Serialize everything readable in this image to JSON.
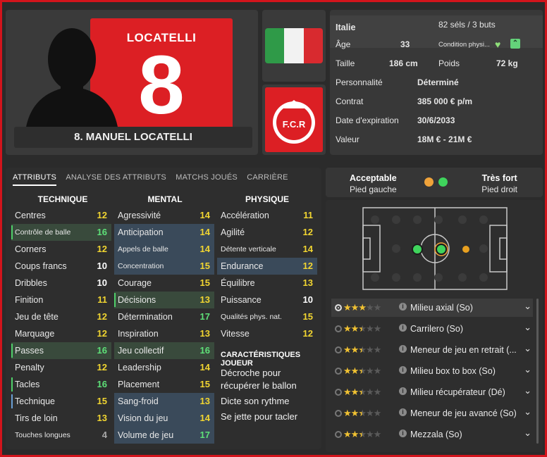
{
  "player": {
    "shirt_name": "LOCATELLI",
    "shirt_number": "8",
    "full_name": "8. MANUEL LOCATELLI"
  },
  "colors": {
    "accent_red": "#dc1f24",
    "attr_yellow": "#f1d531",
    "attr_green": "#5ee078",
    "left_foot_dot": "#f0a33a",
    "right_foot_dot": "#3fd45c"
  },
  "info": {
    "nation": "Italie",
    "caps": "82 séls / 3 buts",
    "age_label": "Âge",
    "age": "33",
    "condition_label": "Condition physi...",
    "height_label": "Taille",
    "height": "186 cm",
    "weight_label": "Poids",
    "weight": "72 kg",
    "personality_label": "Personnalité",
    "personality": "Déterminé",
    "contract_label": "Contrat",
    "contract": "385 000 € p/m",
    "expiry_label": "Date d'expiration",
    "expiry": "30/6/2033",
    "value_label": "Valeur",
    "value": "18M € - 21M €"
  },
  "tabs": [
    "ATTRIBUTS",
    "ANALYSE DES ATTRIBUTS",
    "MATCHS JOUÉS",
    "CARRIÈRE"
  ],
  "columns": {
    "technique": "TECHNIQUE",
    "mental": "MENTAL",
    "physique": "PHYSIQUE"
  },
  "technique": [
    {
      "name": "Centres",
      "value": "12",
      "color": "yellow"
    },
    {
      "name": "Contrôle de balle",
      "value": "16",
      "color": "green"
    },
    {
      "name": "Corners",
      "value": "12",
      "color": "yellow"
    },
    {
      "name": "Coups francs",
      "value": "10",
      "color": "white"
    },
    {
      "name": "Dribbles",
      "value": "10",
      "color": "white"
    },
    {
      "name": "Finition",
      "value": "11",
      "color": "yellow"
    },
    {
      "name": "Jeu de tête",
      "value": "12",
      "color": "yellow"
    },
    {
      "name": "Marquage",
      "value": "12",
      "color": "yellow"
    },
    {
      "name": "Passes",
      "value": "16",
      "color": "green"
    },
    {
      "name": "Penalty",
      "value": "12",
      "color": "yellow"
    },
    {
      "name": "Tacles",
      "value": "16",
      "color": "green"
    },
    {
      "name": "Technique",
      "value": "15",
      "color": "yellow"
    },
    {
      "name": "Tirs de loin",
      "value": "13",
      "color": "yellow"
    },
    {
      "name": "Touches longues",
      "value": "4",
      "color": "grey"
    }
  ],
  "mental": [
    {
      "name": "Agressivité",
      "value": "14",
      "color": "yellow"
    },
    {
      "name": "Anticipation",
      "value": "14",
      "color": "yellow"
    },
    {
      "name": "Appels de balle",
      "value": "14",
      "color": "yellow"
    },
    {
      "name": "Concentration",
      "value": "15",
      "color": "yellow"
    },
    {
      "name": "Courage",
      "value": "15",
      "color": "yellow"
    },
    {
      "name": "Décisions",
      "value": "13",
      "color": "yellow"
    },
    {
      "name": "Détermination",
      "value": "17",
      "color": "green"
    },
    {
      "name": "Inspiration",
      "value": "13",
      "color": "yellow"
    },
    {
      "name": "Jeu collectif",
      "value": "16",
      "color": "green"
    },
    {
      "name": "Leadership",
      "value": "14",
      "color": "yellow"
    },
    {
      "name": "Placement",
      "value": "15",
      "color": "yellow"
    },
    {
      "name": "Sang-froid",
      "value": "13",
      "color": "yellow"
    },
    {
      "name": "Vision du jeu",
      "value": "14",
      "color": "yellow"
    },
    {
      "name": "Volume de jeu",
      "value": "17",
      "color": "green"
    }
  ],
  "physique": [
    {
      "name": "Accélération",
      "value": "11",
      "color": "yellow"
    },
    {
      "name": "Agilité",
      "value": "12",
      "color": "yellow"
    },
    {
      "name": "Détente verticale",
      "value": "14",
      "color": "yellow"
    },
    {
      "name": "Endurance",
      "value": "12",
      "color": "yellow"
    },
    {
      "name": "Équilibre",
      "value": "13",
      "color": "yellow"
    },
    {
      "name": "Puissance",
      "value": "10",
      "color": "white"
    },
    {
      "name": "Qualités phys. nat.",
      "value": "15",
      "color": "yellow"
    },
    {
      "name": "Vitesse",
      "value": "12",
      "color": "yellow"
    }
  ],
  "traits": {
    "heading": "CARACTÉRISTIQUES JOUEUR",
    "items": [
      "Décroche pour",
      "récupérer le ballon",
      "Dicte son rythme",
      "Se jette pour tacler"
    ]
  },
  "feet": {
    "left_rating": "Acceptable",
    "left_label": "Pied gauche",
    "right_rating": "Très fort",
    "right_label": "Pied droit"
  },
  "roles": [
    {
      "name": "Milieu axial (So)",
      "stars": 3,
      "selected": true
    },
    {
      "name": "Carrilero (So)",
      "stars": 2.5,
      "selected": false
    },
    {
      "name": "Meneur de jeu en retrait (...",
      "stars": 2.5,
      "selected": false
    },
    {
      "name": "Milieu box to box (So)",
      "stars": 2.5,
      "selected": false
    },
    {
      "name": "Milieu récupérateur (Dé)",
      "stars": 2.5,
      "selected": false
    },
    {
      "name": "Meneur de jeu avancé (So)",
      "stars": 2.5,
      "selected": false
    },
    {
      "name": "Mezzala (So)",
      "stars": 2.5,
      "selected": false
    }
  ]
}
